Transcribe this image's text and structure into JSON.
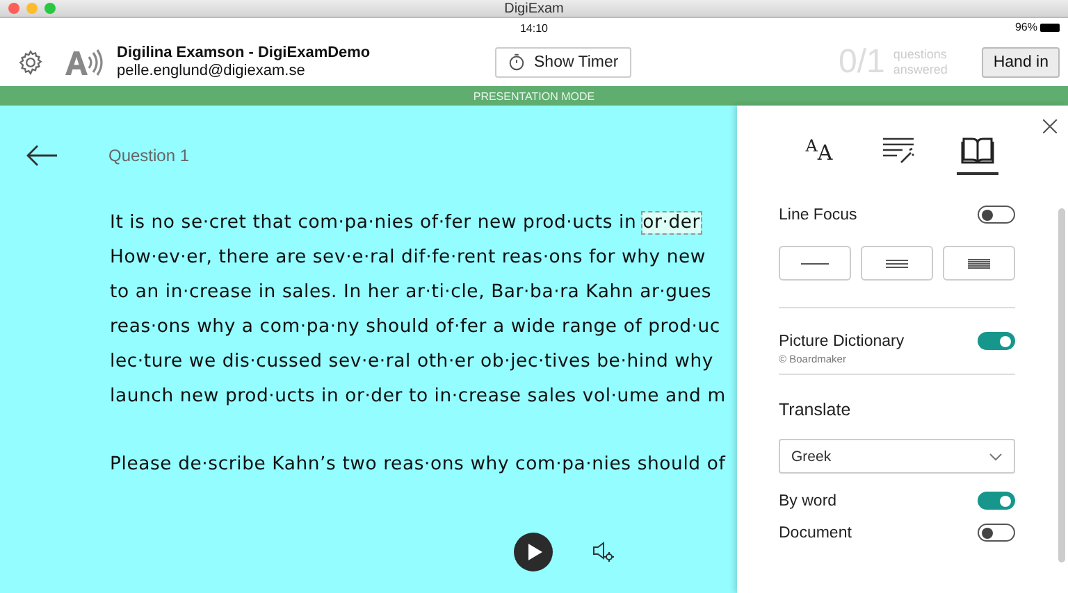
{
  "window": {
    "title": "DigiExam"
  },
  "status_bar": {
    "time": "14:10",
    "battery": "96%"
  },
  "header": {
    "user_name": "Digilina Examson - DigiExamDemo",
    "email": "pelle.englund@digiexam.se",
    "timer_button": "Show Timer",
    "progress": "0/1",
    "progress_label": "questions answered",
    "hand_in_button": "Hand in"
  },
  "mode_banner": "PRESENTATION MODE",
  "question": {
    "title": "Question 1",
    "paragraphs": [
      {
        "lines": [
          {
            "text": "It is no se·cret that com·pa·nies of·fer new prod·ucts in ",
            "highlight": "or·der"
          },
          {
            "text": "How·ev·er, there are sev·e·ral dif·fe·rent reas·ons for why new"
          },
          {
            "text": "to an in·crease in sales. In her ar·ti·cle, Bar·ba·ra Kahn ar·gues"
          },
          {
            "text": "reas·ons why a com·pa·ny should of·fer a wide range of prod·uc"
          },
          {
            "text": "lec·ture we dis·cussed sev·e·ral oth·er ob·jec·tives be·hind why"
          },
          {
            "text": "launch new prod·ucts in or·der to in·crease sales vol·ume and m"
          }
        ]
      },
      {
        "lines": [
          {
            "text": "Please de·scribe Kahn’s two reas·ons why com·pa·nies should of"
          }
        ]
      }
    ]
  },
  "reader_panel": {
    "tabs": [
      {
        "kind": "text-size",
        "glyph": "$^{A}$A",
        "selected": false
      },
      {
        "kind": "grammar",
        "selected": false
      },
      {
        "kind": "reading",
        "selected": true
      }
    ],
    "line_focus": {
      "label": "Line Focus",
      "on": false
    },
    "line_options": [
      {
        "kind": "one"
      },
      {
        "kind": "three"
      },
      {
        "kind": "five"
      }
    ],
    "picture_dictionary": {
      "label": "Picture Dictionary",
      "credit": "© Boardmaker",
      "on": true
    },
    "translate": {
      "title": "Translate",
      "language": "Greek",
      "options": [
        {
          "label": "By word",
          "on": true
        },
        {
          "label": "Document",
          "on": false
        }
      ]
    }
  }
}
